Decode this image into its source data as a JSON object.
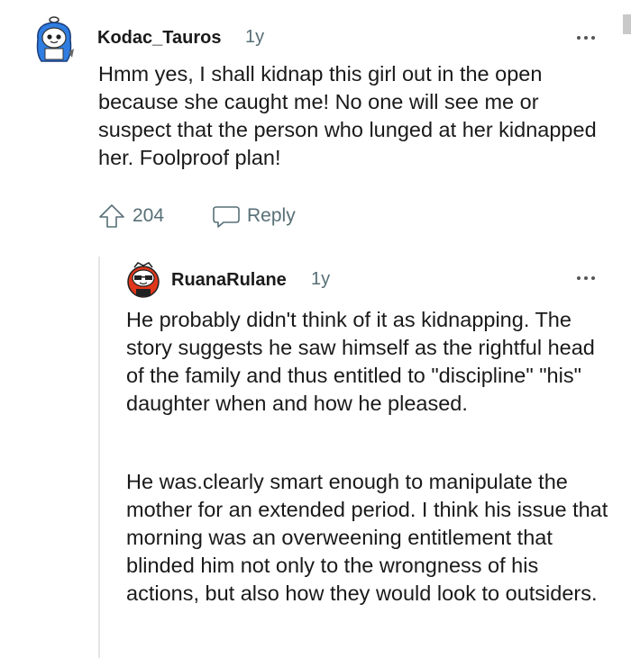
{
  "comment1": {
    "username": "Kodac_Tauros",
    "age": "1y",
    "body": "Hmm yes, I shall kidnap this girl out in the open because she caught me! No one will see me or suspect that the person who lunged at her kidnapped her. Foolproof plan!",
    "upvotes": "204",
    "reply_label": "Reply"
  },
  "comment2": {
    "username": "RuanaRulane",
    "age": "1y",
    "paragraph1": "He probably didn't think of it as kidnapping. The story suggests he saw himself as the rightful head of the family and thus entitled to \"discipline\" \"his\" daughter when and how he pleased.",
    "paragraph2": "He was.clearly smart enough to manipulate the mother for an extended period. I think his issue that morning was an overweening entitlement that blinded him not only to the wrongness of his actions, but also how they would look to outsiders."
  },
  "colors": {
    "text": "#1a1a1b",
    "meta": "#576f76",
    "avatar1_blue": "#2f7de1",
    "avatar2_red": "#e0361a"
  }
}
